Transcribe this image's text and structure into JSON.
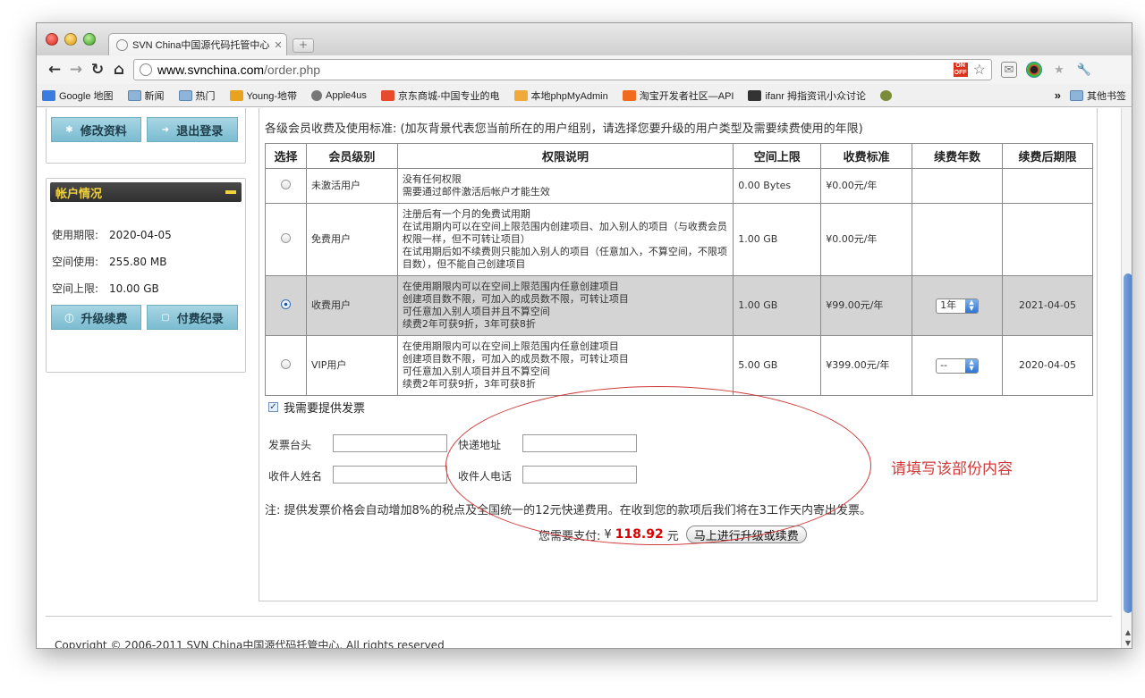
{
  "browser": {
    "tab_title": "SVN China中国源代码托管中心",
    "url_host": "www.svnchina.com",
    "url_path": "/order.php",
    "sale_badge": "ON OFF",
    "bookmarks": [
      {
        "label": "Google 地图",
        "icon": "google-icon",
        "color": "#3b7ddd"
      },
      {
        "label": "新闻",
        "icon": "folder-icon",
        "color": "#8fb4d9"
      },
      {
        "label": "热门",
        "icon": "folder-icon",
        "color": "#8fb4d9"
      },
      {
        "label": "Young-地带",
        "icon": "young-icon",
        "color": "#e8a21e"
      },
      {
        "label": "Apple4us",
        "icon": "apple-icon",
        "color": "#777777"
      },
      {
        "label": "京东商城-中国专业的电",
        "icon": "jd-icon",
        "color": "#e64b2b"
      },
      {
        "label": "本地phpMyAdmin",
        "icon": "pma-icon",
        "color": "#f0a93b"
      },
      {
        "label": "淘宝开发者社区—API",
        "icon": "taobao-icon",
        "color": "#f06b1e"
      },
      {
        "label": "ifanr 拇指资讯小众讨论",
        "icon": "ifanr-icon",
        "color": "#333333"
      },
      {
        "label": "",
        "icon": "bug-icon",
        "color": "#7b8b3a"
      }
    ],
    "overflow_chevron": "»",
    "other_bookmarks": "其他书签"
  },
  "sidebar": {
    "edit_profile": "修改资料",
    "logout": "退出登录",
    "account_title": "帐户情况",
    "expiry_label": "使用期限:",
    "expiry_value": "2020-04-05",
    "used_label": "空间使用:",
    "used_value": "255.80 MB",
    "limit_label": "空间上限:",
    "limit_value": "10.00 GB",
    "upgrade": "升级续费",
    "payments": "付费纪录"
  },
  "main": {
    "intro": "各级会员收费及使用标准: (加灰背景代表您当前所在的用户组别，请选择您要升级的用户类型及需要续费使用的年限)",
    "columns": [
      "选择",
      "会员级别",
      "权限说明",
      "空间上限",
      "收费标准",
      "续费年数",
      "续费后期限"
    ],
    "rows": [
      {
        "level": "未激活用户",
        "desc": [
          "没有任何权限",
          "需要通过邮件激活后帐户才能生效"
        ],
        "space": "0.00 Bytes",
        "fee": "¥0.00元/年",
        "years": "",
        "expiry": "",
        "selected": false
      },
      {
        "level": "免费用户",
        "desc": [
          "注册后有一个月的免费试用期",
          "在试用期内可以在空间上限范围内创建项目、加入别人的项目（与收费会员权限一样，但不可转让项目）",
          "在试用期后如不续费则只能加入别人的项目（任意加入，不算空间，不限项目数），但不能自己创建项目"
        ],
        "space": "1.00 GB",
        "fee": "¥0.00元/年",
        "years": "",
        "expiry": "",
        "selected": false
      },
      {
        "level": "收费用户",
        "desc": [
          "在使用期限内可以在空间上限范围内任意创建项目",
          "创建项目数不限，可加入的成员数不限，可转让项目",
          "可任意加入别人项目并且不算空间",
          "续费2年可获9折，3年可获8折"
        ],
        "space": "1.00 GB",
        "fee": "¥99.00元/年",
        "years": "1年",
        "expiry": "2021-04-05",
        "selected": true
      },
      {
        "level": "VIP用户",
        "desc": [
          "在使用期限内可以在空间上限范围内任意创建项目",
          "创建项目数不限，可加入的成员数不限，可转让项目",
          "可任意加入别人项目并且不算空间",
          "续费2年可获9折，3年可获8折"
        ],
        "space": "5.00 GB",
        "fee": "¥399.00元/年",
        "years": "--",
        "expiry": "2020-04-05",
        "selected": false
      }
    ],
    "invoice_checkbox": "我需要提供发票",
    "invoice_title_label": "发票台头",
    "address_label": "快递地址",
    "recipient_label": "收件人姓名",
    "phone_label": "收件人电话",
    "note": "注: 提供发票价格会自动增加8%的税点及全国统一的12元快递费用。在收到您的款项后我们将在3工作天内寄出发票。",
    "pay_label": "您需要支付:",
    "pay_currency": "¥",
    "pay_amount": "118.92",
    "pay_unit": "元",
    "pay_button": "马上进行升级或续费",
    "annotation": "请填写该部份内容"
  },
  "footer": {
    "copyright": "Copyright © 2006-2011 SVN China中国源代码托管中心. All rights reserved"
  },
  "colors": {
    "accent_red": "#d03a3a",
    "price_red": "#dd0000",
    "teal_button": "#7bbcd1",
    "selected_row": "#d4d4d4"
  }
}
